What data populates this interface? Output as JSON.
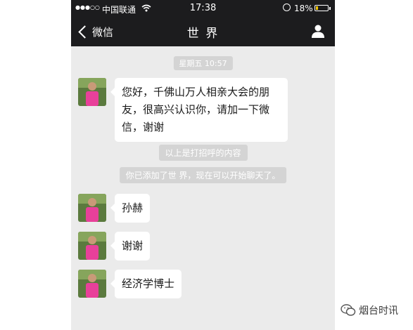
{
  "status_bar": {
    "signal": "●●●○○",
    "carrier": "中国联通",
    "time": "17:38",
    "battery": "18%",
    "battery_level": 0.18
  },
  "nav": {
    "back_label": "微信",
    "title": "世 界"
  },
  "chat": {
    "timestamp": "星期五 10:57",
    "messages": [
      {
        "text": "您好，千佛山万人相亲大会的朋友，很高兴认识你，请加一下微信，谢谢"
      },
      {
        "text": "孙赫"
      },
      {
        "text": "谢谢"
      },
      {
        "text": "经济学博士"
      }
    ],
    "system_notes": [
      "以上是打招呼的内容",
      "你已添加了世  界，现在可以开始聊天了。"
    ]
  },
  "watermark": {
    "text": "烟台时讯"
  },
  "colors": {
    "nav_bg": "#1c1c1e",
    "chat_bg": "#ebebeb",
    "bubble_bg": "#ffffff",
    "pill_bg": "#d4d4d4",
    "battery_fill": "#f0c400"
  },
  "icons": {
    "wifi": "wifi-icon",
    "lock": "orientation-lock-icon",
    "back": "chevron-left-icon",
    "profile": "person-icon",
    "watermark": "wechat-logo-icon"
  }
}
